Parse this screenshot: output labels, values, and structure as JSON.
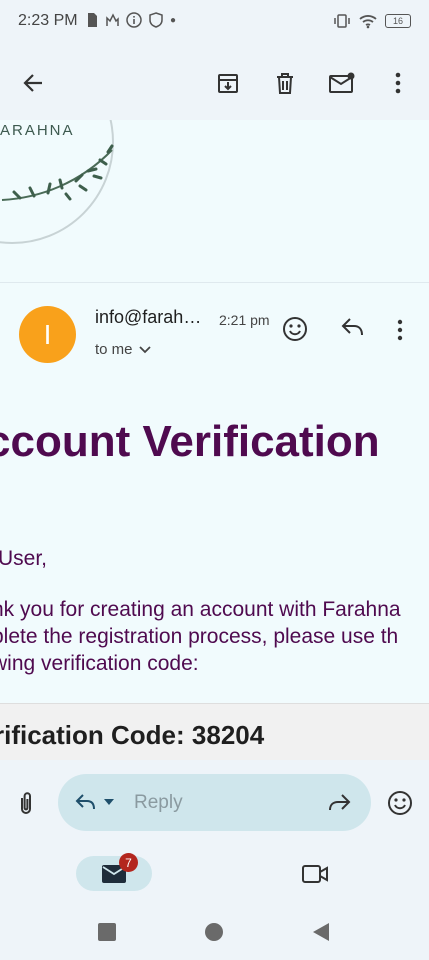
{
  "status_bar": {
    "time": "2:23 PM",
    "battery": "16"
  },
  "toolbar": {
    "back_icon": "arrow-left-icon",
    "archive_icon": "archive-icon",
    "delete_icon": "trash-icon",
    "mark_unread_icon": "mail-unread-icon",
    "more_icon": "more-vert-icon"
  },
  "banner": {
    "logo_text": "ARAHNA"
  },
  "message": {
    "avatar_letter": "I",
    "sender": "info@farah…",
    "time": "2:21 pm",
    "recipient": "to me",
    "heading": "ccount Verification",
    "greeting": "User,",
    "body_line1": "nk you for creating an account with Farahna",
    "body_line2": "plete the registration process, please use th",
    "body_line3": "wing verification code:",
    "code_line": "rification Code: 38204"
  },
  "reply": {
    "placeholder": "Reply"
  },
  "bottom_nav": {
    "mail_badge": "7"
  },
  "colors": {
    "accent": "#4f0a4f",
    "avatar": "#f9a11b",
    "badge": "#b3261e"
  }
}
